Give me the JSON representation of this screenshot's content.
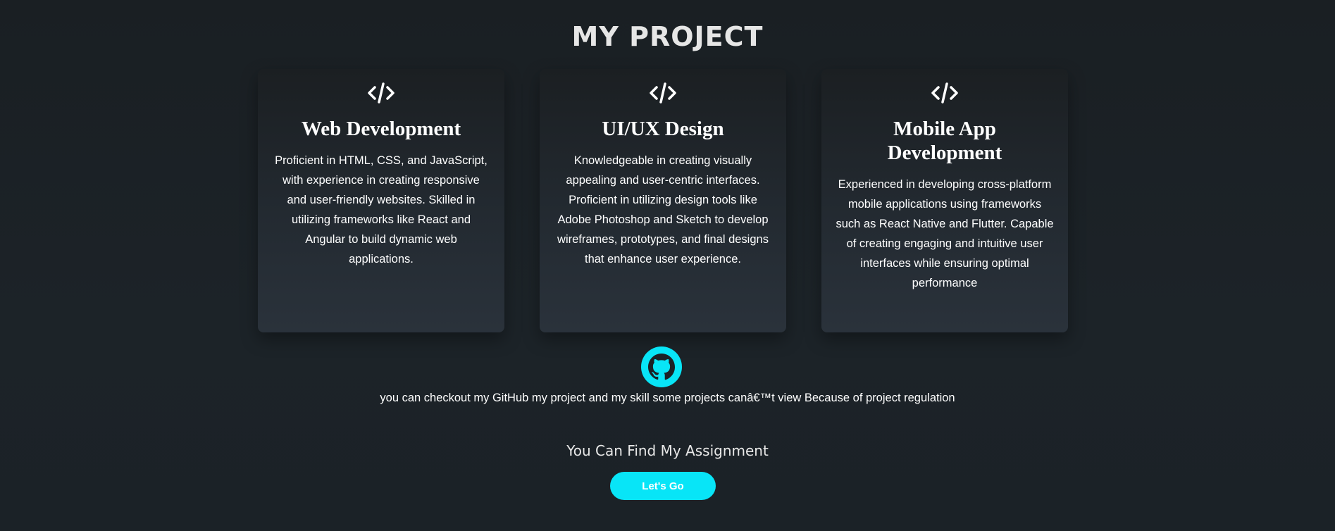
{
  "page": {
    "title": "MY PROJECT"
  },
  "colors": {
    "accent": "#08e5f7",
    "background": "#1b2126",
    "card_background": "#252c33",
    "text": "#ffffff"
  },
  "cards": [
    {
      "icon": "code-icon",
      "title": "Web Development",
      "text": "Proficient in HTML, CSS, and JavaScript, with experience in creating responsive and user-friendly websites. Skilled in utilizing frameworks like React and Angular to build dynamic web applications."
    },
    {
      "icon": "code-icon",
      "title": "UI/UX Design",
      "text": "Knowledgeable in creating visually appealing and user-centric interfaces. Proficient in utilizing design tools like Adobe Photoshop and Sketch to develop wireframes, prototypes, and final designs that enhance user experience."
    },
    {
      "icon": "code-icon",
      "title": "Mobile App Development",
      "text": "Experienced in developing cross-platform mobile applications using frameworks such as React Native and Flutter. Capable of creating engaging and intuitive user interfaces while ensuring optimal performance"
    }
  ],
  "github": {
    "icon": "github-icon",
    "text": "you can checkout my GitHub my project and my skill some projects canâ€™t view Because of project regulation"
  },
  "assignment": {
    "heading": "You Can Find My Assignment",
    "button_label": "Let's Go"
  }
}
